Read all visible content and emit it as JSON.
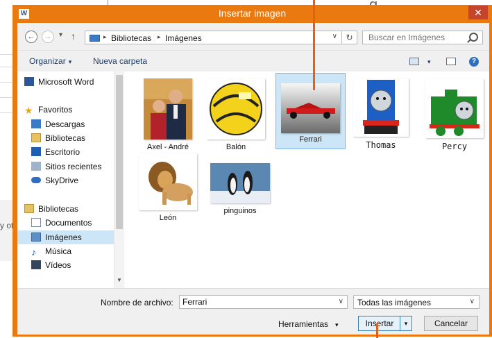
{
  "window": {
    "title": "Insertar imagen",
    "app_icon": "W",
    "close_glyph": "✕"
  },
  "address_bar": {
    "back_glyph": "←",
    "forward_glyph": "→",
    "recent_glyph": "▾",
    "up_glyph": "↑",
    "breadcrumbs": [
      "Bibliotecas",
      "Imágenes"
    ],
    "separator_glyph": "▸",
    "dropdown_glyph": "∨",
    "refresh_glyph": "↻"
  },
  "search": {
    "placeholder": "Buscar en Imágenes"
  },
  "toolbar": {
    "organize_label": "Organizar",
    "new_folder_label": "Nueva carpeta",
    "caret": "▾",
    "help_glyph": "?"
  },
  "nav": {
    "items": [
      {
        "label": "Microsoft Word",
        "icon": "word-doc-icon"
      },
      {
        "label": "Favoritos",
        "icon": "star-icon"
      },
      {
        "label": "Descargas",
        "icon": "downloads-folder-icon"
      },
      {
        "label": "Bibliotecas",
        "icon": "library-icon"
      },
      {
        "label": "Escritorio",
        "icon": "desktop-icon"
      },
      {
        "label": "Sitios recientes",
        "icon": "recent-places-icon"
      },
      {
        "label": "SkyDrive",
        "icon": "cloud-icon"
      },
      {
        "label": "Bibliotecas",
        "icon": "libraries-icon"
      },
      {
        "label": "Documentos",
        "icon": "documents-icon"
      },
      {
        "label": "Imágenes",
        "icon": "pictures-icon",
        "selected": true
      },
      {
        "label": "Música",
        "icon": "music-icon"
      },
      {
        "label": "Vídeos",
        "icon": "videos-icon"
      }
    ]
  },
  "files": [
    {
      "name": "Axel - André",
      "thumb": "photo-two-people"
    },
    {
      "name": "Balón",
      "thumb": "soccer-ball"
    },
    {
      "name": "Ferrari",
      "thumb": "red-race-car",
      "selected": true
    },
    {
      "name": "Thomas",
      "thumb": "blue-train-engine"
    },
    {
      "name": "Percy",
      "thumb": "green-train-engine"
    },
    {
      "name": "León",
      "thumb": "lion"
    },
    {
      "name": "pinguinos",
      "thumb": "penguins"
    }
  ],
  "footer": {
    "filename_label": "Nombre de archivo:",
    "filename_value": "Ferrari",
    "filetype_value": "Todas las imágenes",
    "tools_label": "Herramientas",
    "insert_label": "Insertar",
    "cancel_label": "Cancelar",
    "caret": "▾",
    "dropdown_glyph": "∨"
  },
  "background": {
    "snippet": "y ot",
    "heading_fragment": "g"
  },
  "colors": {
    "title_bar": "#ea7a10",
    "close_button": "#c7442c",
    "selection": "#cde6f7",
    "callout": "#e2601a"
  }
}
